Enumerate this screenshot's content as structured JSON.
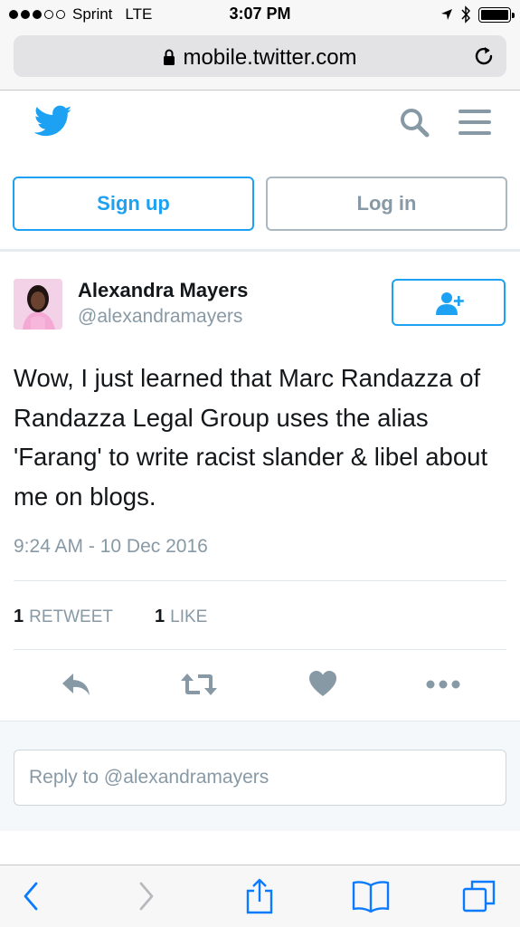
{
  "status_bar": {
    "carrier": "Sprint",
    "network": "LTE",
    "time": "3:07 PM"
  },
  "browser": {
    "url": "mobile.twitter.com"
  },
  "header": {
    "logo_icon": "twitter-bird-icon",
    "search_icon": "search-icon",
    "menu_icon": "hamburger-menu-icon",
    "brand_color": "#1da1f2"
  },
  "auth": {
    "signup_label": "Sign up",
    "login_label": "Log in"
  },
  "tweet": {
    "author_name": "Alexandra Mayers",
    "author_handle": "@alexandramayers",
    "text": "Wow, I just learned that Marc Randazza of Randazza Legal Group uses the alias 'Farang' to write racist slander & libel about me on blogs.",
    "timestamp": "9:24 AM - 10 Dec 2016",
    "retweet_count": "1",
    "retweet_label": "RETWEET",
    "like_count": "1",
    "like_label": "LIKE"
  },
  "reply": {
    "placeholder": "Reply to @alexandramayers"
  },
  "colors": {
    "accent": "#1da1f2",
    "muted": "#8899a6",
    "text": "#14171a",
    "safari_blue": "#0a7aff"
  }
}
